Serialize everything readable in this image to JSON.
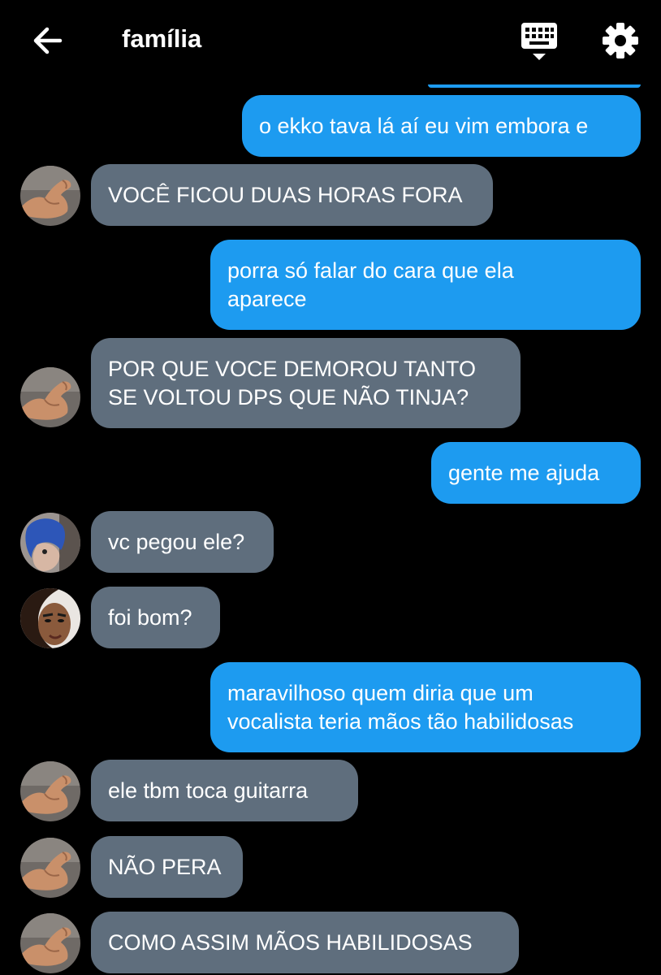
{
  "header": {
    "title": "família",
    "back_icon": "arrow-left-icon",
    "keyboard_icon": "keyboard-icon",
    "settings_icon": "gear-icon"
  },
  "colors": {
    "background": "#000000",
    "outgoing_bubble": "#1d9bf0",
    "incoming_bubble": "#5f6e7d",
    "text": "#ffffff"
  },
  "messages": [
    {
      "direction": "out",
      "text": "o ekko tava lá aí eu vim embora e"
    },
    {
      "direction": "in",
      "sender_avatar": "flexed-arm-avatar",
      "text": "VOCÊ FICOU DUAS HORAS FORA"
    },
    {
      "direction": "out",
      "text": "porra só falar do cara que ela\naparece"
    },
    {
      "direction": "in",
      "sender_avatar": "flexed-arm-avatar",
      "text": "POR QUE VOCE DEMOROU TANTO\nSE VOLTOU DPS QUE NÃO TINJA?"
    },
    {
      "direction": "out",
      "text": "gente me ajuda"
    },
    {
      "direction": "in",
      "sender_avatar": "blue-hair-avatar",
      "text": "vc pegou ele?"
    },
    {
      "direction": "in",
      "sender_avatar": "makeup-face-avatar",
      "text": "foi bom?"
    },
    {
      "direction": "out",
      "text": "maravilhoso quem diria que um\nvocalista teria mãos tão habilidosas"
    },
    {
      "direction": "in",
      "sender_avatar": "flexed-arm-avatar",
      "text": "ele tbm toca guitarra"
    },
    {
      "direction": "in",
      "sender_avatar": "flexed-arm-avatar",
      "text": "NÃO PERA"
    },
    {
      "direction": "in",
      "sender_avatar": "flexed-arm-avatar",
      "text": "COMO ASSIM MÃOS HABILIDOSAS"
    }
  ]
}
